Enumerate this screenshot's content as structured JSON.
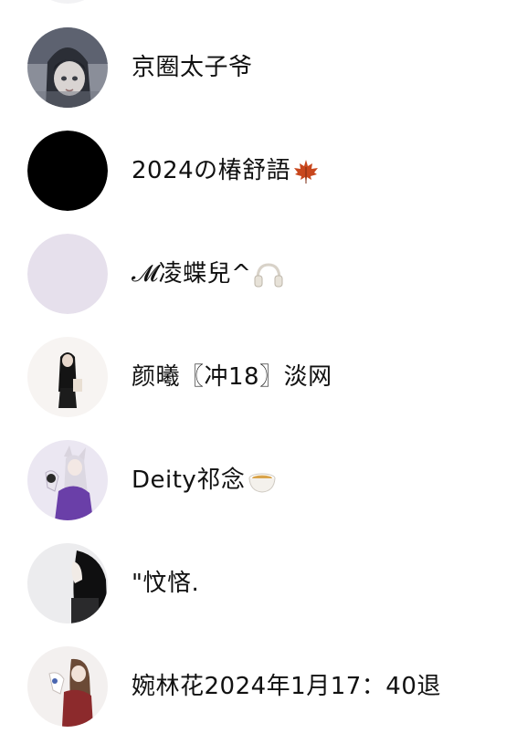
{
  "users": [
    {
      "name": "京圈太子爷",
      "emoji": ""
    },
    {
      "name": "2024の椿舒語",
      "emoji": "maple-leaf"
    },
    {
      "name": "𝓜凌蝶兒^",
      "emoji": "headphones"
    },
    {
      "name": "颜曦〖冲18〗淡网",
      "emoji": ""
    },
    {
      "name": "Deity祁念",
      "emoji": "tea-cup"
    },
    {
      "name": "\"忟悋.",
      "emoji": ""
    },
    {
      "name": "婉林花2024年1月17：40退",
      "emoji": ""
    }
  ],
  "colors": {
    "avatar_black": "#000000",
    "avatar_lavender": "#e6e0ec",
    "text": "#111111"
  }
}
